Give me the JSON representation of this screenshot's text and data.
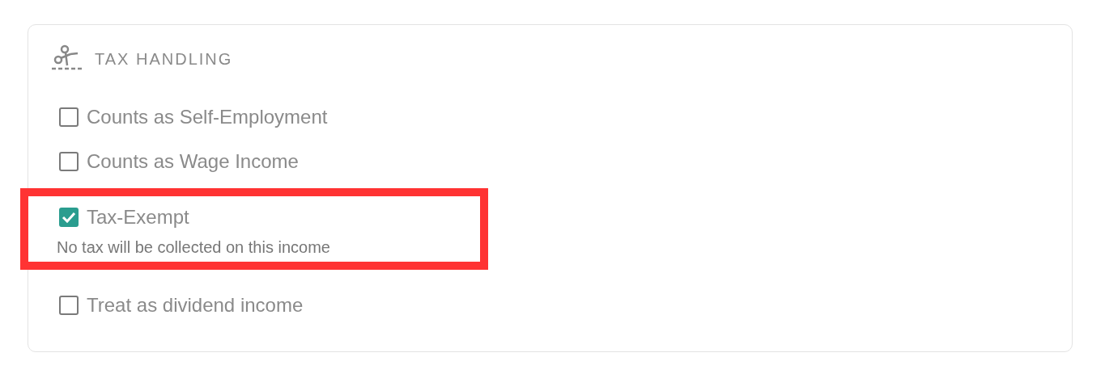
{
  "section": {
    "title": "TAX HANDLING"
  },
  "options": [
    {
      "label": "Counts as Self-Employment",
      "checked": false,
      "highlighted": false
    },
    {
      "label": "Counts as Wage Income",
      "checked": false,
      "highlighted": false
    },
    {
      "label": "Tax-Exempt",
      "checked": true,
      "highlighted": true,
      "note": "No tax will be collected on this income"
    },
    {
      "label": "Treat as dividend income",
      "checked": false,
      "highlighted": false
    }
  ]
}
